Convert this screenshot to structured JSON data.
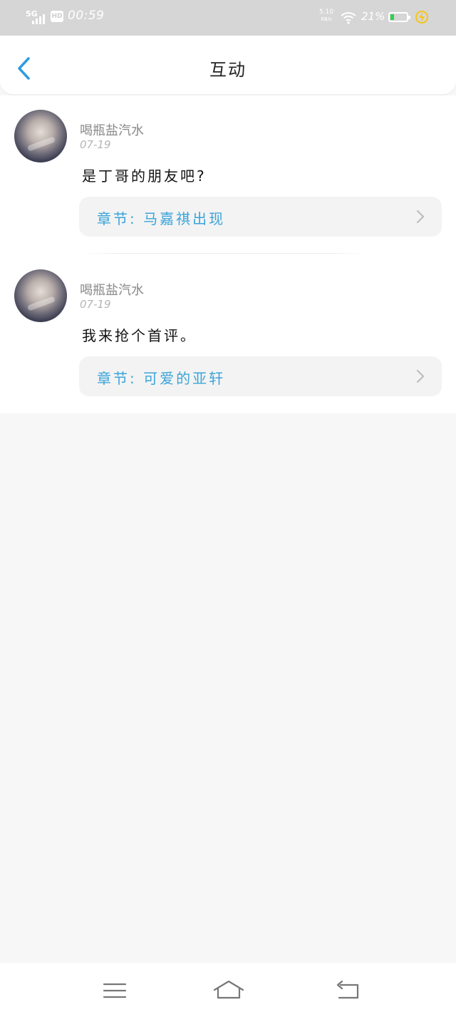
{
  "status_bar": {
    "network": "5G",
    "hd": "HD",
    "time": "00:59",
    "speed_value": "5.10",
    "speed_unit": "KB/s",
    "battery_percent_label": "21%",
    "battery_level": 0.21,
    "battery_fill_color": "#2ed24c",
    "charging_icon_color": "#f5c518"
  },
  "header": {
    "title": "互动",
    "back_icon": "chevron-left-icon",
    "accent_color": "#2f9be0"
  },
  "comments": [
    {
      "username": "喝瓶盐汽水",
      "date": "07-19",
      "text": "是丁哥的朋友吧?",
      "chapter": "章节: 马嘉祺出现"
    },
    {
      "username": "喝瓶盐汽水",
      "date": "07-19",
      "text": "我来抢个首评。",
      "chapter": "章节: 可爱的亚轩"
    }
  ],
  "chapter_link_color": "#3aa4d9",
  "system_nav": {
    "menu_icon": "menu-icon",
    "home_icon": "home-icon",
    "back_icon": "back-icon"
  }
}
